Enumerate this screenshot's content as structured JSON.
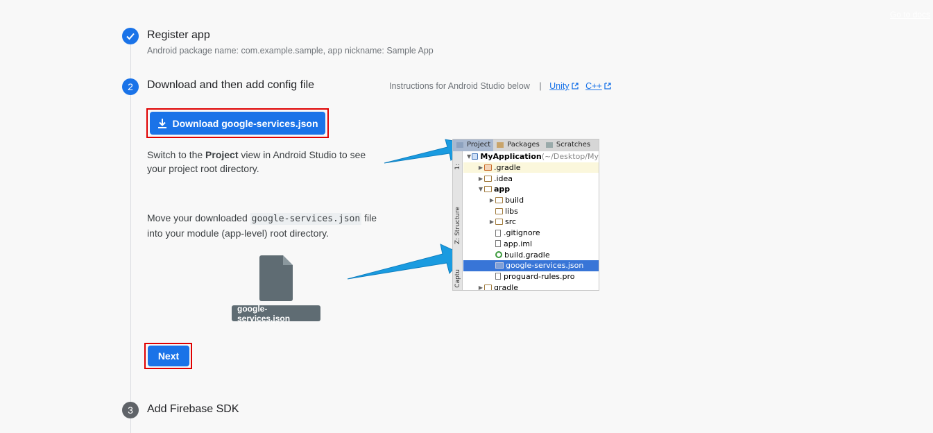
{
  "top_link": "Go to docs",
  "steps": {
    "step1": {
      "title": "Register app",
      "subtitle": "Android package name: com.example.sample, app nickname: Sample App"
    },
    "step2": {
      "number": "2",
      "title": "Download and then add config file",
      "instructions_text": "Instructions for Android Studio below",
      "separator": "|",
      "unity_link": "Unity",
      "cpp_link": "C++",
      "download_button": "Download google-services.json",
      "switch_pre": "Switch to the ",
      "switch_bold": "Project",
      "switch_post": " view in Android Studio to see",
      "switch_line2": "your project root directory.",
      "move_pre": "Move your downloaded ",
      "move_code": "google-services.json",
      "move_post": " file",
      "move_line2": "into your module (app-level) root directory.",
      "file_chip": "google-services.json",
      "next_button": "Next"
    },
    "step3": {
      "number": "3",
      "title": "Add Firebase SDK"
    }
  },
  "ide_panel": {
    "tabs": [
      "Project",
      "Packages",
      "Scratches"
    ],
    "side_labels": [
      "1:",
      "Z: Structure",
      "Captu"
    ],
    "tree": [
      {
        "indent": 0,
        "toggle": "▼",
        "icon": "module",
        "label": "MyApplication",
        "suffix": " (~/Desktop/My",
        "bold": true
      },
      {
        "indent": 1,
        "toggle": "▶",
        "icon": "folder-orange",
        "label": ".gradle",
        "highlight": "yellow"
      },
      {
        "indent": 1,
        "toggle": "▶",
        "icon": "folder",
        "label": ".idea"
      },
      {
        "indent": 1,
        "toggle": "▼",
        "icon": "folder",
        "label": "app",
        "bold": true
      },
      {
        "indent": 2,
        "toggle": "▶",
        "icon": "folder",
        "label": "build"
      },
      {
        "indent": 2,
        "toggle": "",
        "icon": "folder",
        "label": "libs"
      },
      {
        "indent": 2,
        "toggle": "▶",
        "icon": "folder",
        "label": "src"
      },
      {
        "indent": 2,
        "toggle": "",
        "icon": "file",
        "label": ".gitignore"
      },
      {
        "indent": 2,
        "toggle": "",
        "icon": "file",
        "label": "app.iml"
      },
      {
        "indent": 2,
        "toggle": "",
        "icon": "gradle",
        "label": "build.gradle"
      },
      {
        "indent": 2,
        "toggle": "",
        "icon": "json",
        "label": "google-services.json",
        "selected": true
      },
      {
        "indent": 2,
        "toggle": "",
        "icon": "file",
        "label": "proguard-rules.pro"
      },
      {
        "indent": 1,
        "toggle": "▶",
        "icon": "folder",
        "label": "gradle"
      }
    ]
  },
  "colors": {
    "primary": "#1a73e8",
    "completed": "#1a73e8",
    "pending": "#5f6368",
    "highlight_box": "#e00000",
    "arrow": "#1a9be0"
  }
}
